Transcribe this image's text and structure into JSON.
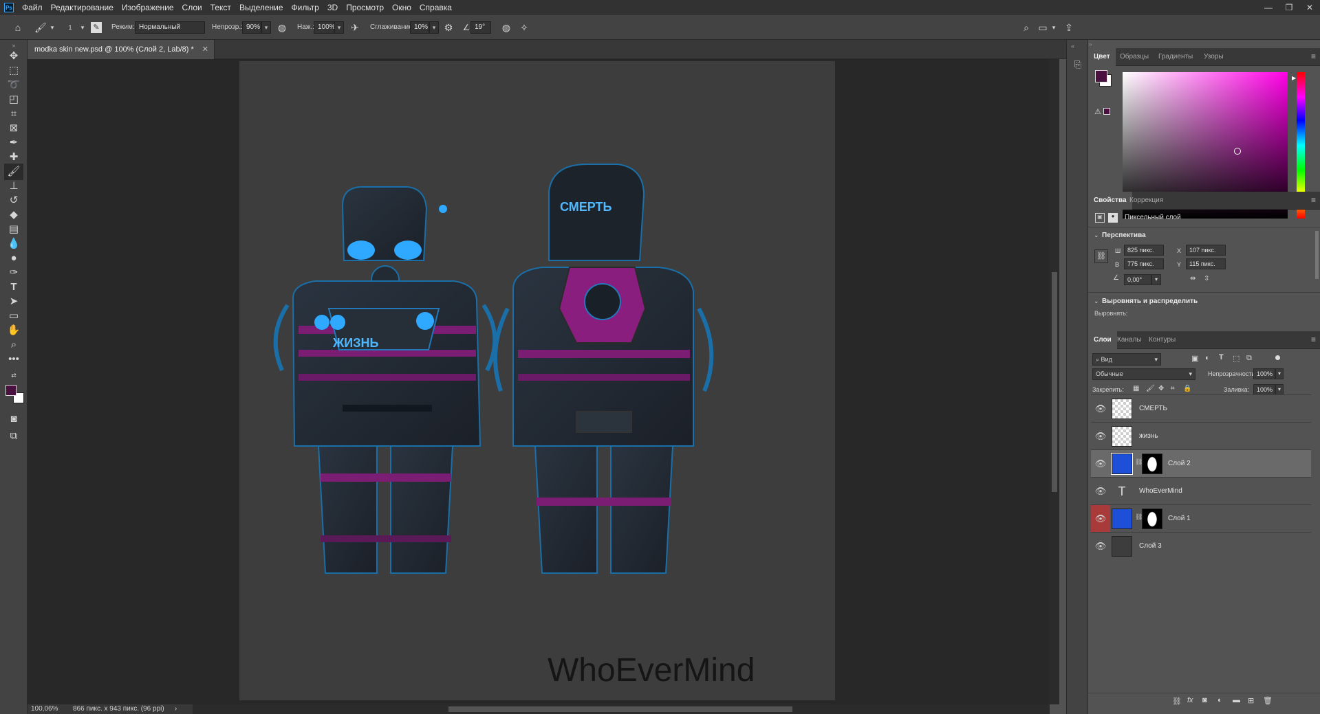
{
  "app": {
    "logo": "Ps"
  },
  "menu": [
    "Файл",
    "Редактирование",
    "Изображение",
    "Слои",
    "Текст",
    "Выделение",
    "Фильтр",
    "3D",
    "Просмотр",
    "Окно",
    "Справка"
  ],
  "options": {
    "brush_size": "1",
    "mode_label": "Режим:",
    "mode_value": "Нормальный",
    "opacity_label": "Непрозр.:",
    "opacity_value": "90%",
    "pressure_label": "Наж.:",
    "pressure_value": "100%",
    "smoothing_label": "Сглаживание:",
    "smoothing_value": "10%",
    "angle_value": "19°"
  },
  "document": {
    "tab_title": "modka skin new.psd @ 100% (Слой 2, Lab/8) *",
    "canvas_labels": {
      "front_chest": "ЖИЗНЬ",
      "back_helmet": "СМЕРТЬ",
      "signature": "WhoEverMind"
    }
  },
  "status": {
    "zoom": "100,06%",
    "size": "866 пикс. x 943 пикс. (96 ppi)"
  },
  "color_panel": {
    "tabs": [
      "Цвет",
      "Образцы",
      "Градиенты",
      "Узоры"
    ],
    "foreground": "#4a1040",
    "background": "#ffffff",
    "hue_color": "#ff00e6"
  },
  "properties": {
    "tabs": [
      "Свойства",
      "Коррекция"
    ],
    "layer_type": "Пиксельный слой",
    "perspective_title": "Перспектива",
    "w_label": "Ш",
    "w_value": "825 пикс.",
    "h_label": "В",
    "h_value": "775 пикс.",
    "x_label": "X",
    "x_value": "107 пикс.",
    "y_label": "Y",
    "y_value": "115 пикс.",
    "angle_value": "0,00°",
    "align_title": "Выровнять и распределить",
    "align_label": "Выровнять:"
  },
  "layers_panel": {
    "tabs": [
      "Слои",
      "Каналы",
      "Контуры"
    ],
    "filter_value": "Вид",
    "blend_value": "Обычные",
    "opacity_label": "Непрозрачность:",
    "opacity_value": "100%",
    "lock_label": "Закрепить:",
    "fill_label": "Заливка:",
    "fill_value": "100%",
    "layers": [
      {
        "name": "СМЕРТЬ",
        "kind": "transparent"
      },
      {
        "name": "жизнь",
        "kind": "transparent"
      },
      {
        "name": "Слой 2",
        "kind": "masked",
        "selected": true
      },
      {
        "name": "WhoEverMind",
        "kind": "text"
      },
      {
        "name": "Слой 1",
        "kind": "masked"
      },
      {
        "name": "Слой 3",
        "kind": "solid"
      }
    ]
  }
}
